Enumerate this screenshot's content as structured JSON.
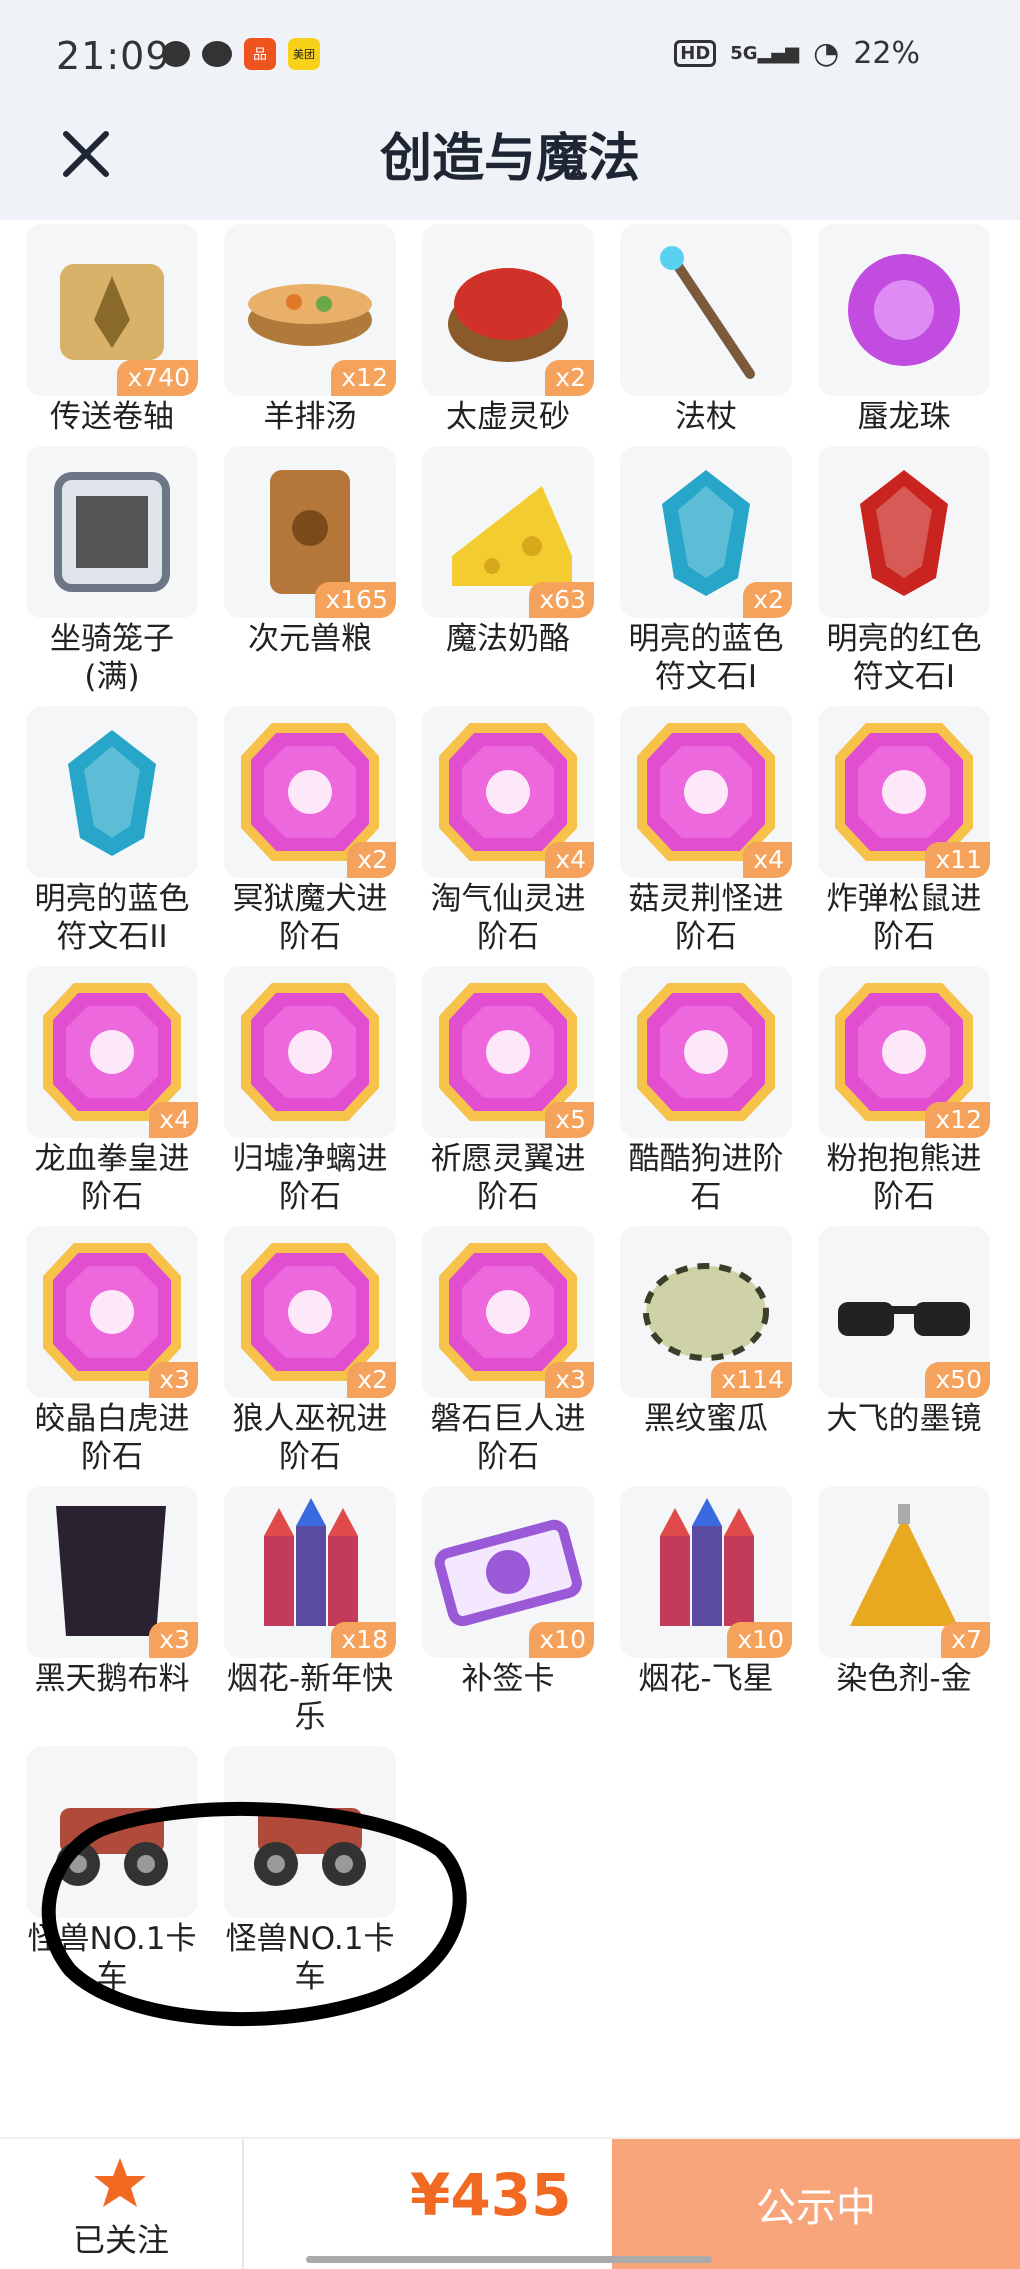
{
  "status": {
    "time": "21:09",
    "network": "5G",
    "battery": "22%",
    "hd": "HD",
    "app_badge": "美团"
  },
  "header": {
    "title": "创造与魔法"
  },
  "items": [
    {
      "name": "传送卷轴",
      "count": "x740",
      "icon": "scroll-icon",
      "color": "#d9b26a"
    },
    {
      "name": "羊排汤",
      "count": "x12",
      "icon": "soup-bowl-icon",
      "color": "#b07a3a"
    },
    {
      "name": "太虚灵砂",
      "count": "x2",
      "icon": "red-sand-bowl-icon",
      "color": "#d0322a"
    },
    {
      "name": "法杖",
      "count": "",
      "icon": "staff-icon",
      "color": "#7a5a3a"
    },
    {
      "name": "蜃龙珠",
      "count": "",
      "icon": "purple-orb-icon",
      "color": "#c24be0"
    },
    {
      "name": "坐骑笼子(满)",
      "count": "",
      "icon": "cage-icon",
      "color": "#6c7686"
    },
    {
      "name": "次元兽粮",
      "count": "x165",
      "icon": "feed-bag-icon",
      "color": "#b5763a"
    },
    {
      "name": "魔法奶酪",
      "count": "x63",
      "icon": "cheese-icon",
      "color": "#f3cd2f"
    },
    {
      "name": "明亮的蓝色符文石I",
      "count": "x2",
      "icon": "blue-rune-icon",
      "color": "#27a6c9"
    },
    {
      "name": "明亮的红色符文石I",
      "count": "",
      "icon": "red-rune-icon",
      "color": "#c9241f"
    },
    {
      "name": "明亮的蓝色符文石II",
      "count": "",
      "icon": "blue-rune-icon",
      "color": "#27a6c9"
    },
    {
      "name": "冥狱魔犬进阶石",
      "count": "x2",
      "icon": "gem-icon",
      "color": "#e14fd0"
    },
    {
      "name": "淘气仙灵进阶石",
      "count": "x4",
      "icon": "gem-icon",
      "color": "#e14fd0"
    },
    {
      "name": "菇灵荆怪进阶石",
      "count": "x4",
      "icon": "gem-icon",
      "color": "#e14fd0"
    },
    {
      "name": "炸弹松鼠进阶石",
      "count": "x11",
      "icon": "gem-icon",
      "color": "#e14fd0"
    },
    {
      "name": "龙血拳皇进阶石",
      "count": "x4",
      "icon": "gem-icon",
      "color": "#e14fd0"
    },
    {
      "name": "归墟净螭进阶石",
      "count": "",
      "icon": "gem-icon",
      "color": "#e14fd0"
    },
    {
      "name": "祈愿灵翼进阶石",
      "count": "x5",
      "icon": "gem-icon",
      "color": "#e14fd0"
    },
    {
      "name": "酷酷狗进阶石",
      "count": "",
      "icon": "gem-icon",
      "color": "#e14fd0"
    },
    {
      "name": "粉抱抱熊进阶石",
      "count": "x12",
      "icon": "gem-icon",
      "color": "#e14fd0"
    },
    {
      "name": "皎晶白虎进阶石",
      "count": "x3",
      "icon": "gem-icon",
      "color": "#e14fd0"
    },
    {
      "name": "狼人巫祝进阶石",
      "count": "x2",
      "icon": "gem-icon",
      "color": "#e14fd0"
    },
    {
      "name": "磐石巨人进阶石",
      "count": "x3",
      "icon": "gem-icon",
      "color": "#e14fd0"
    },
    {
      "name": "黑纹蜜瓜",
      "count": "x114",
      "icon": "melon-icon",
      "color": "#8a8f6a"
    },
    {
      "name": "大飞的墨镜",
      "count": "x50",
      "icon": "sunglasses-icon",
      "color": "#222222"
    },
    {
      "name": "黑天鹅布料",
      "count": "x3",
      "icon": "cloth-icon",
      "color": "#2a2230"
    },
    {
      "name": "烟花-新年快乐",
      "count": "x18",
      "icon": "firework-icon",
      "color": "#c43a5a"
    },
    {
      "name": "补签卡",
      "count": "x10",
      "icon": "ticket-icon",
      "color": "#9a5ad8"
    },
    {
      "name": "烟花-飞星",
      "count": "x10",
      "icon": "firework-icon",
      "color": "#c43a5a"
    },
    {
      "name": "染色剂-金",
      "count": "x7",
      "icon": "dye-bottle-icon",
      "color": "#e8a820"
    },
    {
      "name": "怪兽NO.1卡车",
      "count": "",
      "icon": "monster-truck-icon",
      "color": "#b04a3a"
    },
    {
      "name": "怪兽NO.1卡车",
      "count": "",
      "icon": "monster-truck-icon",
      "color": "#b04a3a"
    }
  ],
  "bottom": {
    "follow_label": "已关注",
    "price": "¥435",
    "status_button": "公示中"
  }
}
